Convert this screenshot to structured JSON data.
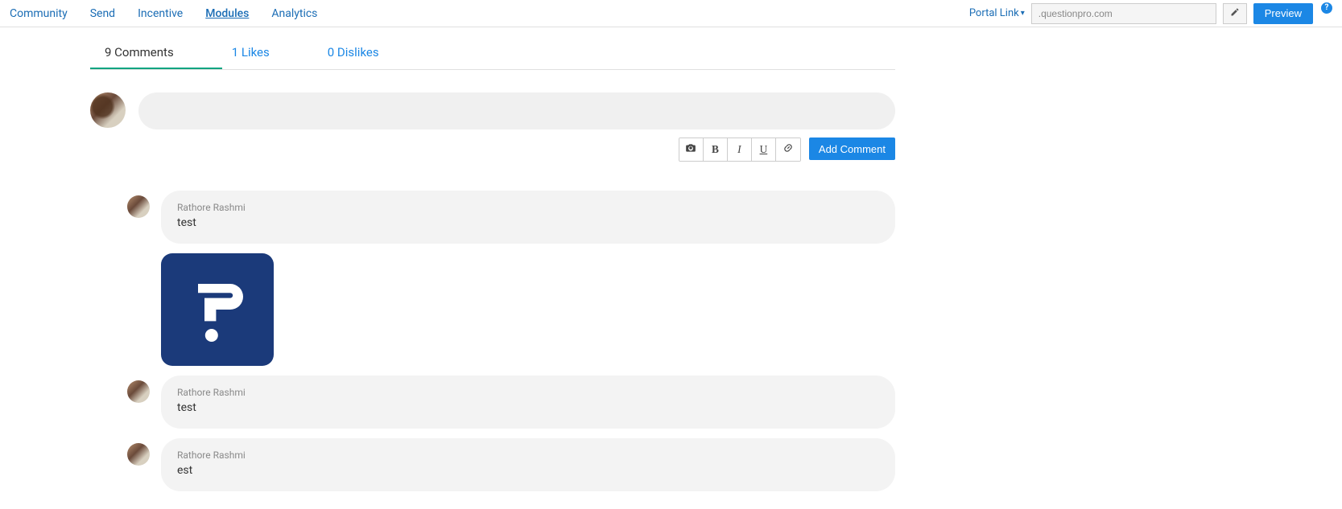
{
  "nav": {
    "items": [
      "Community",
      "Send",
      "Incentive",
      "Modules",
      "Analytics"
    ],
    "active_index": 3
  },
  "portal": {
    "link_label": "Portal Link",
    "url_suffix": ".questionpro.com",
    "preview": "Preview",
    "help": "?"
  },
  "tabs": {
    "comments": {
      "count": 9,
      "label": "Comments"
    },
    "likes": {
      "count": 1,
      "label": "Likes"
    },
    "dislikes": {
      "count": 0,
      "label": "Dislikes"
    }
  },
  "toolbar": {
    "add_comment": "Add Comment"
  },
  "comments": [
    {
      "author": "Rathore Rashmi",
      "text": "test",
      "has_attachment": true
    },
    {
      "author": "Rathore Rashmi",
      "text": "test",
      "has_attachment": false
    },
    {
      "author": "Rathore Rashmi",
      "text": "est",
      "has_attachment": false
    }
  ]
}
